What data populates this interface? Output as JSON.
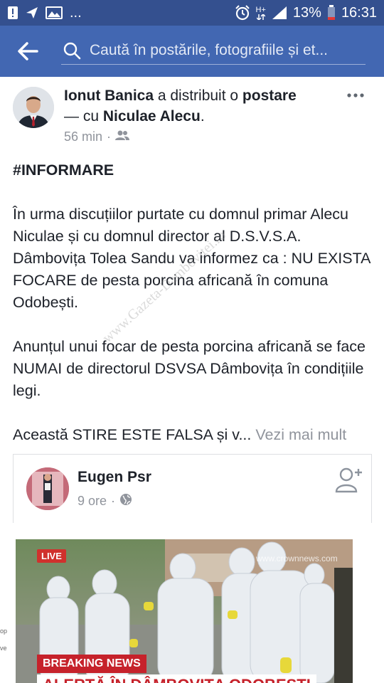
{
  "status_bar": {
    "signal_label": "H+",
    "battery": "13%",
    "time": "16:31",
    "overflow": "...",
    "icons": [
      "alert-icon",
      "send-icon",
      "gallery-icon",
      "alarm-icon",
      "network-icon",
      "signal-icon",
      "battery-icon"
    ]
  },
  "search": {
    "placeholder": "Caută în postările, fotografiile și et..."
  },
  "post": {
    "author": "Ionut Banica",
    "action_text": " a distribuit o ",
    "object": "postare",
    "with_text": " — cu ",
    "tagged": "Niculae Alecu",
    "tail": ".",
    "time": "56 min",
    "privacy_sep": "·",
    "hashtag": "#INFORMARE",
    "para1": "În urma discuțiilor purtate cu domnul primar Alecu Niculae și cu domnul director al D.S.V.S.A. Dâmbovița Tolea Sandu va informez ca : NU EXISTA FOCARE de pesta porcina africană în comuna Odobești.",
    "para2": "Anunțul unui focar de pesta porcina africană se face NUMAI de directorul DSVSA Dâmbovița în condițiile legi.",
    "para3": "Această STIRE ESTE FALSA și v...",
    "see_more": " Vezi mai mult"
  },
  "watermark": "www.Gazeta-Dambovitei.ro",
  "shared": {
    "name": "Eugen Psr",
    "time": "9 ore",
    "sep": "·"
  },
  "news": {
    "live": "LIVE",
    "site": "www.crownnews.com",
    "breaking": "BREAKING NEWS",
    "headline": "ALERTĂ ÎN DÂMBOVIȚA ODOBEȘTI"
  },
  "side_strip": [
    "op",
    "ve"
  ],
  "colors": {
    "statusbar": "#34508f",
    "searchbar": "#4267b2",
    "breaking": "#c6222b",
    "live": "#d0312d"
  }
}
